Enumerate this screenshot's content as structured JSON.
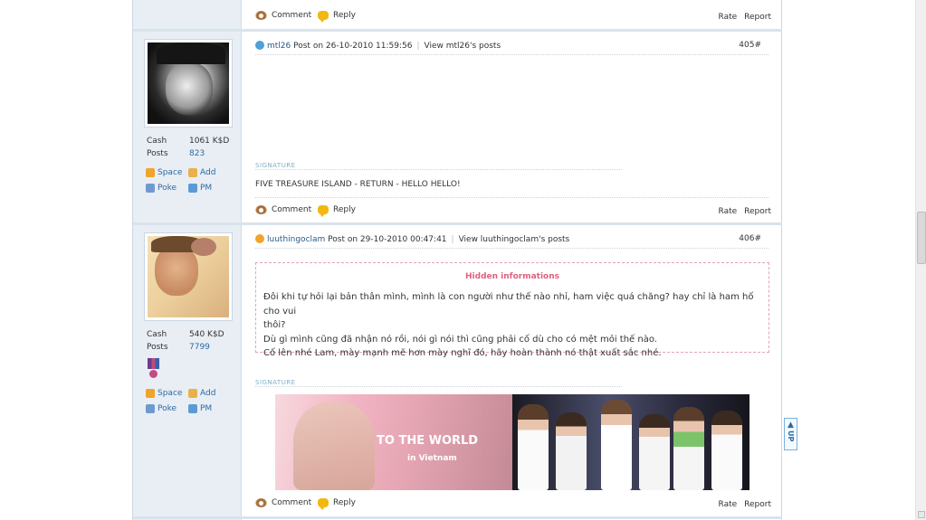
{
  "actions": {
    "comment": "Comment",
    "reply": "Reply",
    "rate": "Rate",
    "report": "Report"
  },
  "posts": [
    {
      "username": "mtl26",
      "posted": "Post on 26-10-2010 11:59:56",
      "view_posts": "View mtl26's posts",
      "number": "405#",
      "cash_label": "Cash",
      "cash_value": "1061 K$D",
      "posts_label": "Posts",
      "posts_value": "823",
      "links": {
        "space": "Space",
        "add": "Add",
        "poke": "Poke",
        "pm": "PM"
      },
      "signature_label": "SIGNATURE",
      "signature_text": "FIVE TREASURE ISLAND - RETURN - HELLO HELLO!"
    },
    {
      "username": "luuthingoclam",
      "posted": "Post on 29-10-2010 00:47:41",
      "view_posts": "View luuthingoclam's posts",
      "number": "406#",
      "cash_label": "Cash",
      "cash_value": "540 K$D",
      "posts_label": "Posts",
      "posts_value": "7799",
      "links": {
        "space": "Space",
        "add": "Add",
        "poke": "Poke",
        "pm": "PM"
      },
      "hidden_title": "Hidden informations",
      "hidden_lines": [
        "Đôi khi tự hỏi lại bản thân mình, mình là con người như thế nào nhỉ, ham việc quá chăng? hay chỉ là ham hố cho vui",
        "thôi?",
        "Dù gì mình cũng đã nhận nó rồi, nói gì nói thì cũng phải cố dù cho có mệt mỏi thế nào.",
        "Cố lên nhé Lam, mày mạnh mẽ hơn mày nghĩ đó, hãy hoàn thành nó thật xuất sắc nhé."
      ],
      "signature_label": "SIGNATURE",
      "banner_text_1": "TO THE WORLD",
      "banner_text_2": "in Vietnam"
    }
  ],
  "up_button": "UP"
}
